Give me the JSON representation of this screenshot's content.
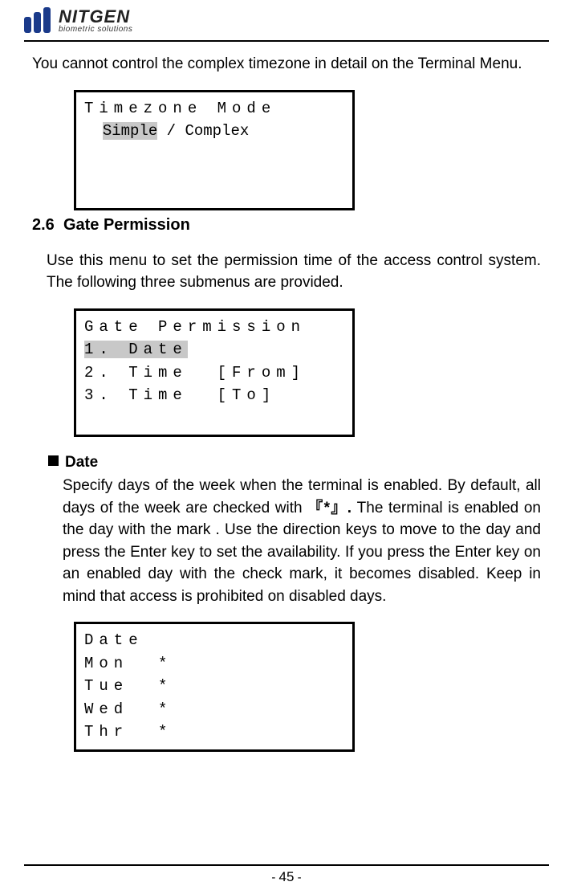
{
  "logo": {
    "name": "NITGEN",
    "tagline": "biometric solutions"
  },
  "intro_para": "You cannot control the complex timezone in detail on the Terminal Menu.",
  "lcd1": {
    "title": "Timezone Mode",
    "selected": "Simple",
    "rest": " / Complex"
  },
  "section_2_6": {
    "number": "2.6",
    "title": "Gate Permission",
    "para": "Use this menu to set the permission time of the access control system. The following three submenus are provided."
  },
  "lcd2": {
    "title": "Gate Permission",
    "item1_sel": "1. Date",
    "item2": "2. Time  [From]",
    "item3": "3. Time  [To]"
  },
  "date_section": {
    "heading": "Date",
    "para_a": "Specify days of the week when the terminal is enabled. By default, all days of the week are checked with ",
    "mark_pre": "『",
    "mark_star": "*",
    "mark_post": "』.",
    "para_b": " The terminal is enabled on the day with the mark . Use the direction keys to move to the day and press the Enter key to set the availability. If you press the Enter key on an enabled day with the check mark, it becomes disabled. Keep in mind that access is prohibited on disabled days."
  },
  "lcd3": {
    "title": "Date",
    "rows": [
      "Mon  *",
      "Tue  *",
      "Wed  *",
      "Thr  *"
    ]
  },
  "footer": {
    "pre": "- ",
    "num": "45",
    "post": " -"
  }
}
